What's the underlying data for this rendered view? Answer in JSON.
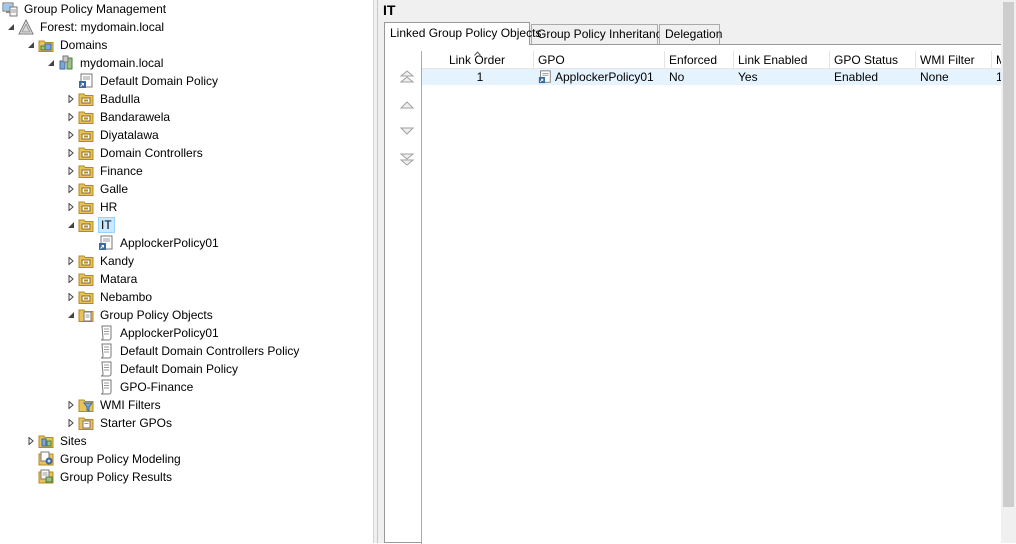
{
  "tree": {
    "root": "Group Policy Management",
    "forest": "Forest: mydomain.local",
    "domains": "Domains",
    "domain": "mydomain.local",
    "default_domain_policy": "Default Domain Policy",
    "ous": [
      "Badulla",
      "Bandarawela",
      "Diyatalawa",
      "Domain Controllers",
      "Finance",
      "Galle",
      "HR"
    ],
    "selected_ou": "IT",
    "selected_ou_child": "ApplockerPolicy01",
    "ous_after": [
      "Kandy",
      "Matara",
      "Nebambo"
    ],
    "gpo_container": "Group Policy Objects",
    "gpos": [
      "ApplockerPolicy01",
      "Default Domain Controllers Policy",
      "Default Domain Policy",
      "GPO-Finance"
    ],
    "wmi_filters": "WMI Filters",
    "starter_gpos": "Starter GPOs",
    "sites": "Sites",
    "modeling": "Group Policy Modeling",
    "results": "Group Policy Results"
  },
  "details": {
    "title": "IT",
    "tabs": [
      "Linked Group Policy Objects",
      "Group Policy Inheritance",
      "Delegation"
    ],
    "columns": [
      "Link Order",
      "GPO",
      "Enforced",
      "Link Enabled",
      "GPO Status",
      "WMI Filter",
      "M"
    ],
    "rows": [
      {
        "link_order": "1",
        "gpo": "ApplockerPolicy01",
        "enforced": "No",
        "link_enabled": "Yes",
        "gpo_status": "Enabled",
        "wmi_filter": "None",
        "modified": "1"
      }
    ]
  },
  "colors": {
    "selection_bg": "#cce8ff",
    "row_highlight": "#e5f3ff",
    "folder_yellow": "#e8c35a"
  }
}
